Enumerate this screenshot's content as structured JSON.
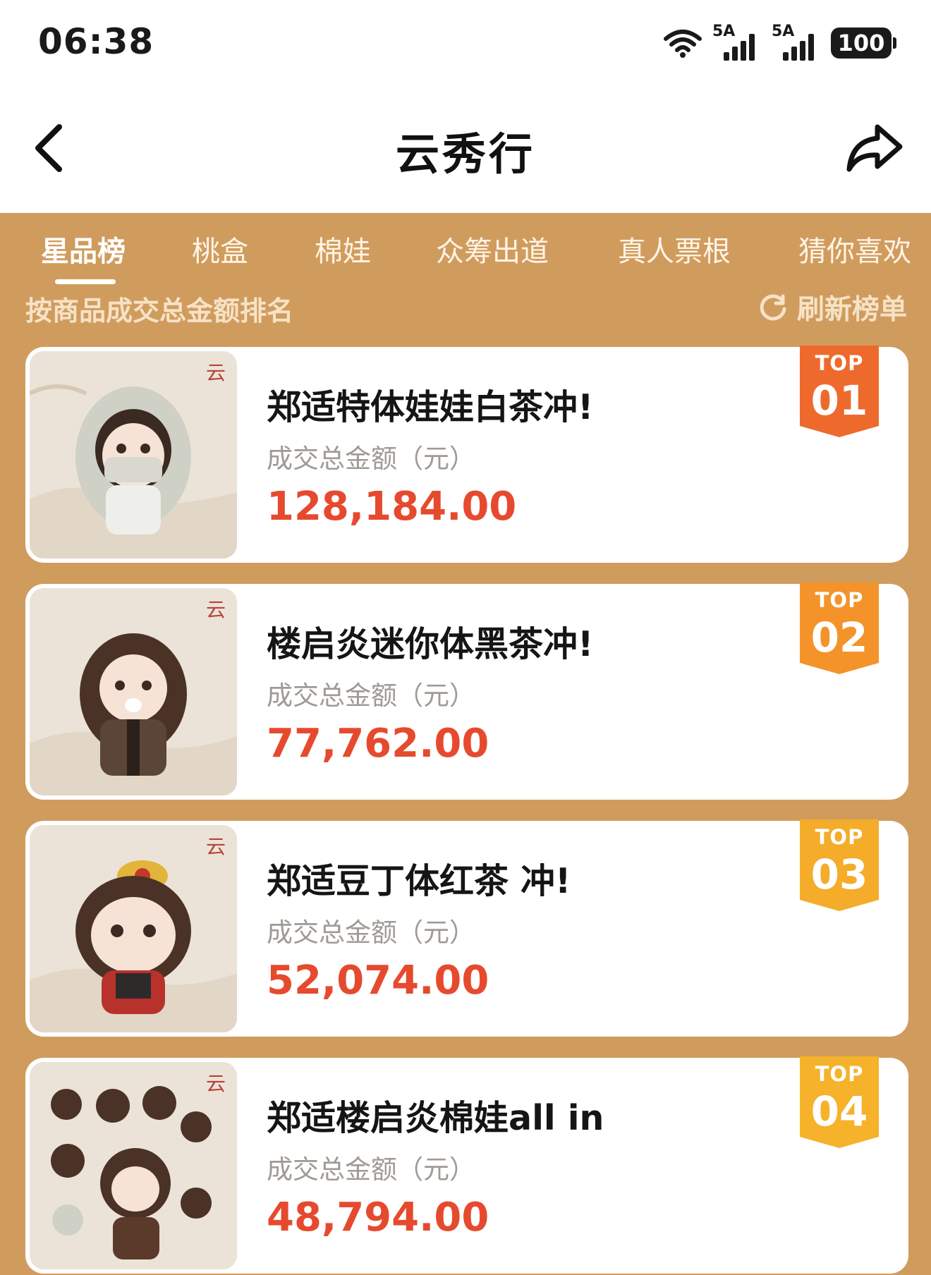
{
  "status_bar": {
    "time": "06:38",
    "signal_1": "5A",
    "signal_2": "5A",
    "battery": "100",
    "icons": [
      "wifi-icon",
      "signal-icon",
      "signal-icon",
      "battery-icon"
    ]
  },
  "nav": {
    "title": "云秀行",
    "back_icon": "chevron-left-icon",
    "share_icon": "share-arrow-icon"
  },
  "tabs": [
    {
      "label": "星品榜",
      "active": true
    },
    {
      "label": "桃盒",
      "active": false
    },
    {
      "label": "棉娃",
      "active": false
    },
    {
      "label": "众筹出道",
      "active": false
    },
    {
      "label": "真人票根",
      "active": false
    },
    {
      "label": "猜你喜欢",
      "active": false
    }
  ],
  "ranking": {
    "subtitle": "按商品成交总金额排名",
    "refresh_label": "刷新榜单",
    "refresh_icon": "refresh-icon"
  },
  "items": [
    {
      "badge_top": "TOP",
      "rank": "01",
      "title": "郑适特体娃娃白茶冲!",
      "amount_label": "成交总金额（元）",
      "amount": "128,184.00",
      "badge_color": "#ee6a2c"
    },
    {
      "badge_top": "TOP",
      "rank": "02",
      "title": "楼启炎迷你体黑茶冲!",
      "amount_label": "成交总金额（元）",
      "amount": "77,762.00",
      "badge_color": "#f4932a"
    },
    {
      "badge_top": "TOP",
      "rank": "03",
      "title": "郑适豆丁体红茶 冲!",
      "amount_label": "成交总金额（元）",
      "amount": "52,074.00",
      "badge_color": "#f4ac2a"
    },
    {
      "badge_top": "TOP",
      "rank": "04",
      "title": "郑适楼启炎棉娃all in",
      "amount_label": "成交总金额（元）",
      "amount": "48,794.00",
      "badge_color": "#f5b22a"
    }
  ],
  "colors": {
    "panel_bg": "#d09c5e",
    "amount": "#e64a2e",
    "badge_1": "#ee6a2c",
    "badge_2": "#f4932a",
    "badge_3": "#f4ac2a",
    "badge_4": "#f5b22a"
  }
}
